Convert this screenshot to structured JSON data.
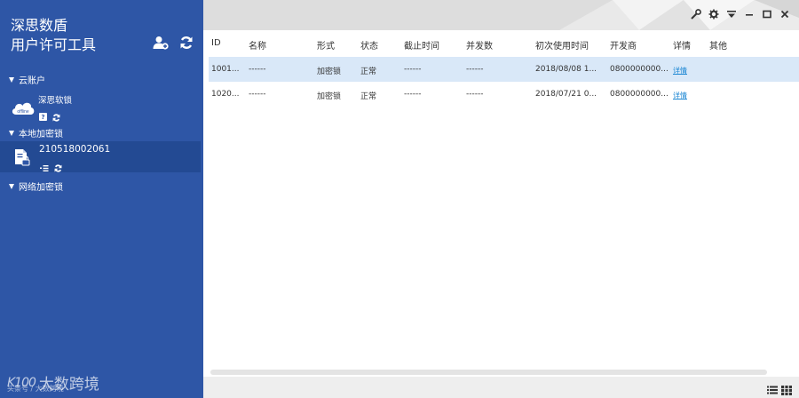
{
  "app": {
    "title_line1": "深思数盾",
    "title_line2": "用户许可工具"
  },
  "sidebar": {
    "cloud_section": "云账户",
    "cloud_account": {
      "name": "深思软锁",
      "status": "offline",
      "help": "?"
    },
    "local_section": "本地加密锁",
    "local_dongle": {
      "id": "210518002061"
    },
    "network_section": "网络加密锁"
  },
  "table": {
    "columns": [
      "ID",
      "名称",
      "形式",
      "状态",
      "截止时间",
      "并发数",
      "初次使用时间",
      "开发商",
      "详情",
      "其他"
    ],
    "rows": [
      {
        "id": "1001...",
        "name": "------",
        "form": "加密锁",
        "state": "正常",
        "expire": "------",
        "concurrency": "------",
        "first_use": "2018/08/08 1...",
        "developer": "0800000000...",
        "detail": "详情",
        "other": ""
      },
      {
        "id": "1020...",
        "name": "------",
        "form": "加密锁",
        "state": "正常",
        "expire": "------",
        "concurrency": "------",
        "first_use": "2018/07/21 0...",
        "developer": "0800000000...",
        "detail": "详情",
        "other": ""
      }
    ],
    "selected_row": 0
  },
  "watermark": {
    "logo": "K100",
    "text": "大数跨境",
    "sub": "头条号 / 大数跨境"
  },
  "colors": {
    "sidebar_bg": "#2e56a6",
    "selected_dongle_bg": "#234a93",
    "selected_row_bg": "#d9e8f8",
    "link": "#1b86d3"
  }
}
